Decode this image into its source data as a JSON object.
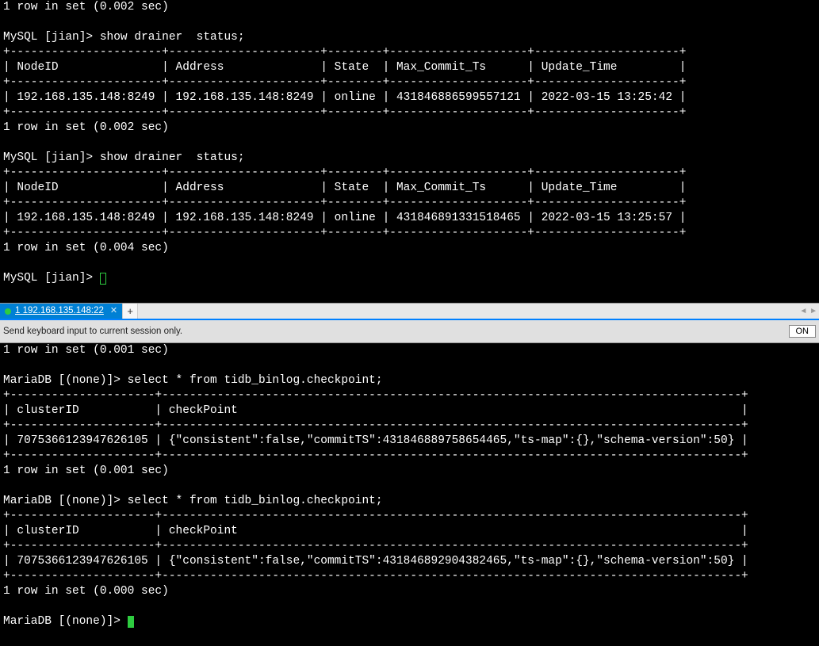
{
  "tab": {
    "label": "1 192.168.135.148:22"
  },
  "info_bar": {
    "text": "Send keyboard input to current session only.",
    "on": "ON"
  },
  "top": {
    "row_msg0": "1 row in set (0.002 sec)",
    "prompt1": "MySQL [jian]> show drainer  status;",
    "sep": "+----------------------+----------------------+--------+--------------------+---------------------+",
    "head": "| NodeID               | Address              | State  | Max_Commit_Ts      | Update_Time         |",
    "row1": "| 192.168.135.148:8249 | 192.168.135.148:8249 | online | 431846886599557121 | 2022-03-15 13:25:42 |",
    "row_msg1": "1 row in set (0.002 sec)",
    "prompt2": "MySQL [jian]> show drainer  status;",
    "row2": "| 192.168.135.148:8249 | 192.168.135.148:8249 | online | 431846891331518465 | 2022-03-15 13:25:57 |",
    "row_msg2": "1 row in set (0.004 sec)",
    "prompt3": "MySQL [jian]> "
  },
  "bottom": {
    "row_msg0": "1 row in set (0.001 sec)",
    "prompt1": "MariaDB [(none)]> select * from tidb_binlog.checkpoint;",
    "sep": "+---------------------+------------------------------------------------------------------------------------+",
    "head": "| clusterID           | checkPoint                                                                         |",
    "row1": "| 7075366123947626105 | {\"consistent\":false,\"commitTS\":431846889758654465,\"ts-map\":{},\"schema-version\":50} |",
    "row_msg1": "1 row in set (0.001 sec)",
    "prompt2": "MariaDB [(none)]> select * from tidb_binlog.checkpoint;",
    "row2": "| 7075366123947626105 | {\"consistent\":false,\"commitTS\":431846892904382465,\"ts-map\":{},\"schema-version\":50} |",
    "row_msg2": "1 row in set (0.000 sec)",
    "prompt3": "MariaDB [(none)]> "
  }
}
